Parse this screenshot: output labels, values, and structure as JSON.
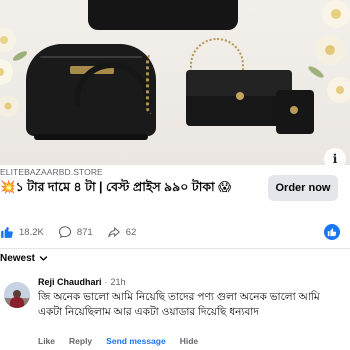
{
  "ad": {
    "image_alt": "black handbag set",
    "domain": "ELITEBAZAARBD.STORE",
    "headline": "💥১ টার দামে ৪ টা | বেস্ট প্রাইস ৯৯০ টাকা 😱",
    "cta_label": "Order now"
  },
  "stats": {
    "likes": "18.2K",
    "comments": "871",
    "shares": "62"
  },
  "sort": {
    "label": "Newest"
  },
  "comment": {
    "author": "Reji Chaudhari",
    "separator": "·",
    "time": "21h",
    "text": "জি অনেক ভালো আমি নিয়েছি তাদের পণ্য গুলা অনেক ভালো আমি একটা নিয়েছিলাম আর একটা ওয়াডার দিয়েছি ধন্যবাদ",
    "actions": {
      "like": "Like",
      "reply": "Reply",
      "send_message": "Send message",
      "hide": "Hide"
    }
  },
  "colors": {
    "brand_blue": "#1877f2",
    "muted_text": "#65676b",
    "button_gray": "#e4e6eb"
  },
  "icons": [
    "info-icon",
    "like-icon",
    "comment-icon",
    "share-icon",
    "like-badge-icon",
    "chevron-down-icon"
  ]
}
